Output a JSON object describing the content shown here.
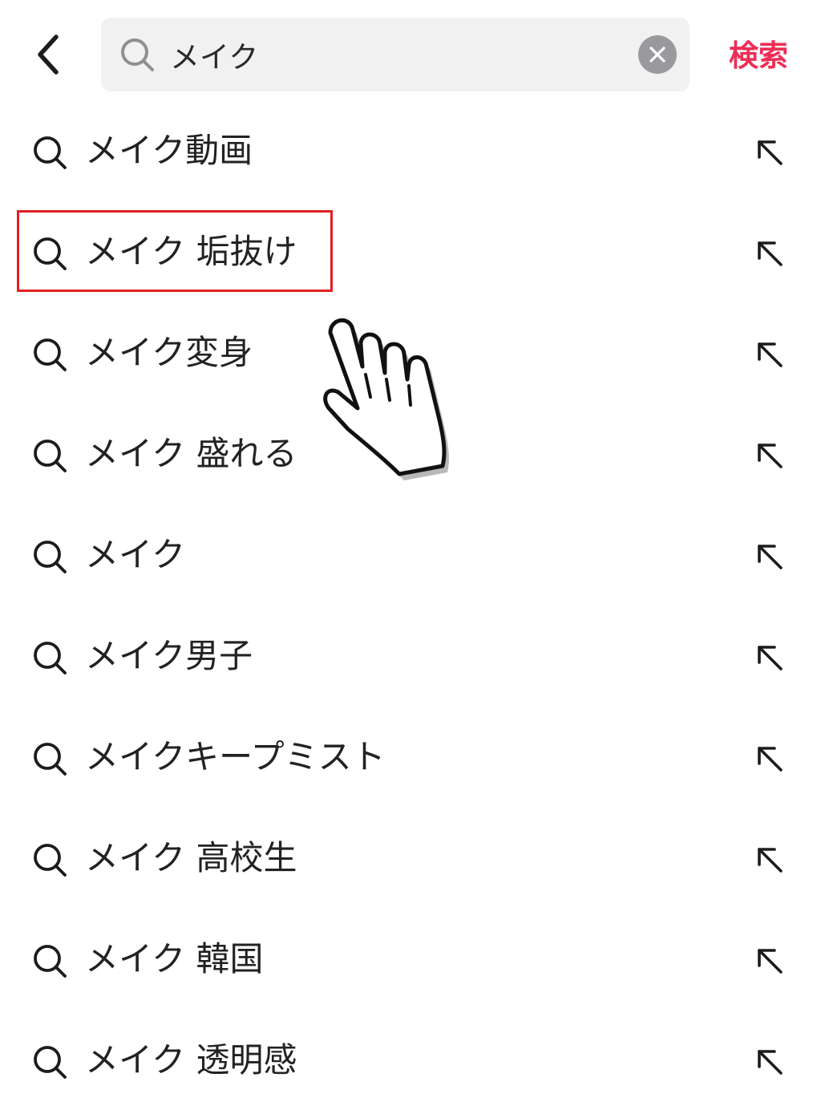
{
  "search": {
    "value": "メイク",
    "submit_label": "検索"
  },
  "suggestions": [
    {
      "label": "メイク動画"
    },
    {
      "label": "メイク 垢抜け"
    },
    {
      "label": "メイク変身"
    },
    {
      "label": "メイク 盛れる"
    },
    {
      "label": "メイク"
    },
    {
      "label": "メイク男子"
    },
    {
      "label": "メイクキープミスト"
    },
    {
      "label": "メイク 高校生"
    },
    {
      "label": "メイク 韓国"
    },
    {
      "label": "メイク 透明感"
    }
  ],
  "highlighted_suggestion": "メイク 垢抜け",
  "colors": {
    "accent": "#ee2d56",
    "search_bg": "#f1f1f2",
    "clear_bg": "#9a9a9e",
    "highlight_border": "#e02020"
  },
  "icons": {
    "back": "chevron-left-icon",
    "search": "search-icon",
    "clear": "clear-x-icon",
    "fill": "arrow-up-left-icon",
    "pointer": "hand-pointer-icon"
  }
}
